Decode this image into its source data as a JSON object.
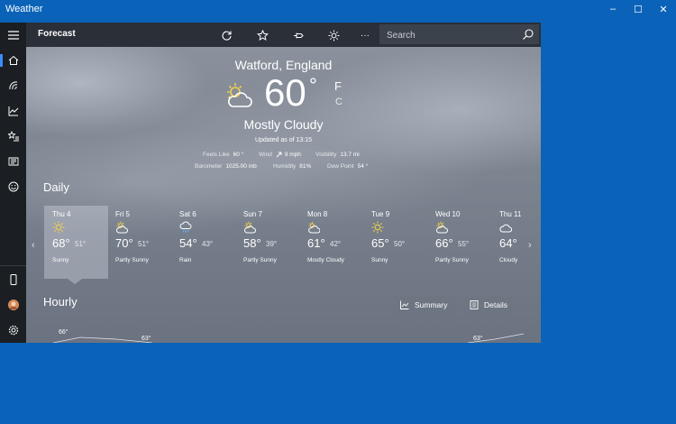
{
  "window": {
    "title": "Weather",
    "min": "–",
    "max": "☐",
    "close": "✕"
  },
  "toolbar": {
    "title": "Forecast",
    "more": "···"
  },
  "search": {
    "placeholder": "Search"
  },
  "current": {
    "city": "Watford, England",
    "temp": "60",
    "deg": "°",
    "unit_f": "F",
    "unit_c": "C",
    "condition": "Mostly Cloudy",
    "updated": "Updated as of 13:15",
    "details": {
      "feels_like_label": "Feels Like",
      "feels_like": "60 °",
      "wind_label": "Wind",
      "wind": "9 mph",
      "visibility_label": "Visibility",
      "visibility": "13.7 mi",
      "barometer_label": "Barometer",
      "barometer": "1025.00 mb",
      "humidity_label": "Humidity",
      "humidity": "81%",
      "dew_point_label": "Dew Point",
      "dew_point": "54 °"
    }
  },
  "daily": {
    "title": "Daily",
    "days": [
      {
        "name": "Thu 4",
        "hi": "68°",
        "lo": "51°",
        "cond": "Sunny",
        "icon": "sun-icon"
      },
      {
        "name": "Fri 5",
        "hi": "70°",
        "lo": "51°",
        "cond": "Partly Sunny",
        "icon": "partly-sunny-icon"
      },
      {
        "name": "Sat 6",
        "hi": "54°",
        "lo": "43°",
        "cond": "Rain",
        "icon": "rain-icon"
      },
      {
        "name": "Sun 7",
        "hi": "58°",
        "lo": "39°",
        "cond": "Partly Sunny",
        "icon": "partly-sunny-icon"
      },
      {
        "name": "Mon 8",
        "hi": "61°",
        "lo": "42°",
        "cond": "Mostly Cloudy",
        "icon": "mostly-cloudy-icon"
      },
      {
        "name": "Tue 9",
        "hi": "65°",
        "lo": "50°",
        "cond": "Sunny",
        "icon": "sun-icon"
      },
      {
        "name": "Wed 10",
        "hi": "66°",
        "lo": "55°",
        "cond": "Partly Sunny",
        "icon": "partly-sunny-icon"
      },
      {
        "name": "Thu 11",
        "hi": "64°",
        "lo": "",
        "cond": "Cloudy",
        "icon": "cloudy-icon"
      }
    ],
    "prev": "‹",
    "next": "›"
  },
  "hourly": {
    "title": "Hourly",
    "summary_label": "Summary",
    "details_label": "Details",
    "temps": [
      "66°",
      "63°",
      "63°"
    ]
  }
}
